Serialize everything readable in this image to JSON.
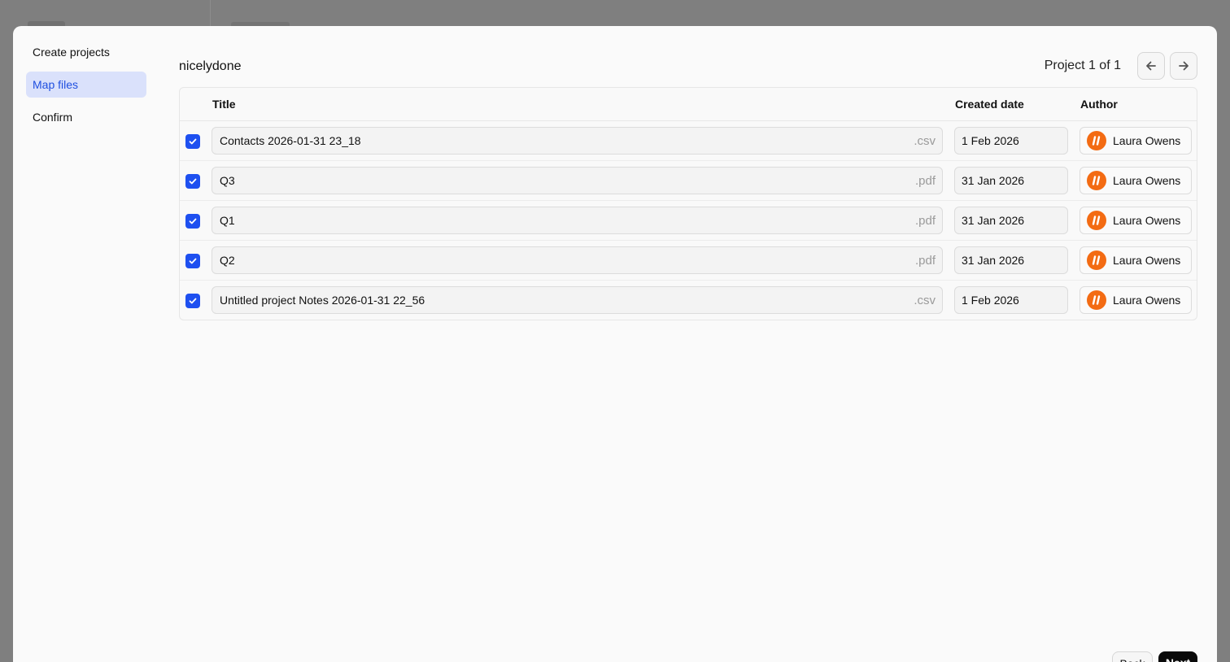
{
  "steps": [
    {
      "label": "Create projects",
      "active": false
    },
    {
      "label": "Map files",
      "active": true
    },
    {
      "label": "Confirm",
      "active": false
    }
  ],
  "project": {
    "name": "nicelydone"
  },
  "pager": {
    "text": "Project 1 of 1",
    "prev_icon": "arrow-left-icon",
    "next_icon": "arrow-right-icon"
  },
  "table": {
    "headers": {
      "title": "Title",
      "created": "Created date",
      "author": "Author"
    },
    "rows": [
      {
        "checked": true,
        "title": "Contacts 2026-01-31 23_18",
        "ext": ".csv",
        "date": "1 Feb 2026",
        "author": "Laura Owens"
      },
      {
        "checked": true,
        "title": "Q3",
        "ext": ".pdf",
        "date": "31 Jan 2026",
        "author": "Laura Owens"
      },
      {
        "checked": true,
        "title": "Q1",
        "ext": ".pdf",
        "date": "31 Jan 2026",
        "author": "Laura Owens"
      },
      {
        "checked": true,
        "title": "Q2",
        "ext": ".pdf",
        "date": "31 Jan 2026",
        "author": "Laura Owens"
      },
      {
        "checked": true,
        "title": "Untitled project Notes 2026-01-31 22_56",
        "ext": ".csv",
        "date": "1 Feb 2026",
        "author": "Laura Owens"
      }
    ]
  },
  "footer": {
    "back_label": "Back",
    "next_label": "Next"
  },
  "colors": {
    "accent": "#1e50f0",
    "active_step_bg": "#dae1fb",
    "avatar": "#f36b13"
  }
}
